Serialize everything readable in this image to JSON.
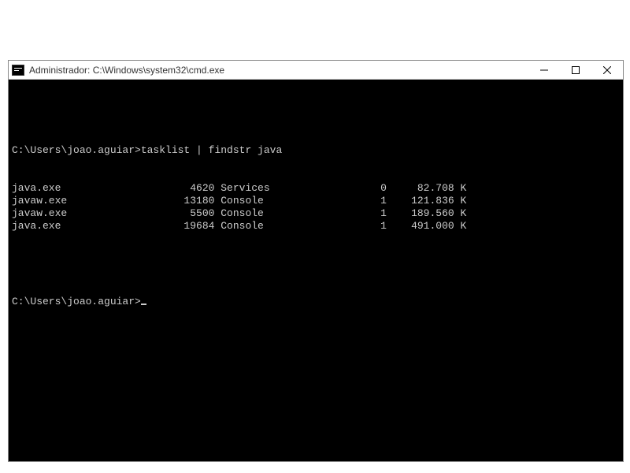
{
  "window": {
    "title": "Administrador: C:\\Windows\\system32\\cmd.exe"
  },
  "terminal": {
    "prompt1": "C:\\Users\\joao.aguiar>",
    "command1": "tasklist | findstr java",
    "rows": [
      {
        "name": "java.exe",
        "pid": "4620",
        "sessName": "Services",
        "sess": "0",
        "mem": "82.708 K"
      },
      {
        "name": "javaw.exe",
        "pid": "13180",
        "sessName": "Console",
        "sess": "1",
        "mem": "121.836 K"
      },
      {
        "name": "javaw.exe",
        "pid": "5500",
        "sessName": "Console",
        "sess": "1",
        "mem": "189.560 K"
      },
      {
        "name": "java.exe",
        "pid": "19684",
        "sessName": "Console",
        "sess": "1",
        "mem": "491.000 K"
      }
    ],
    "prompt2": "C:\\Users\\joao.aguiar>"
  }
}
